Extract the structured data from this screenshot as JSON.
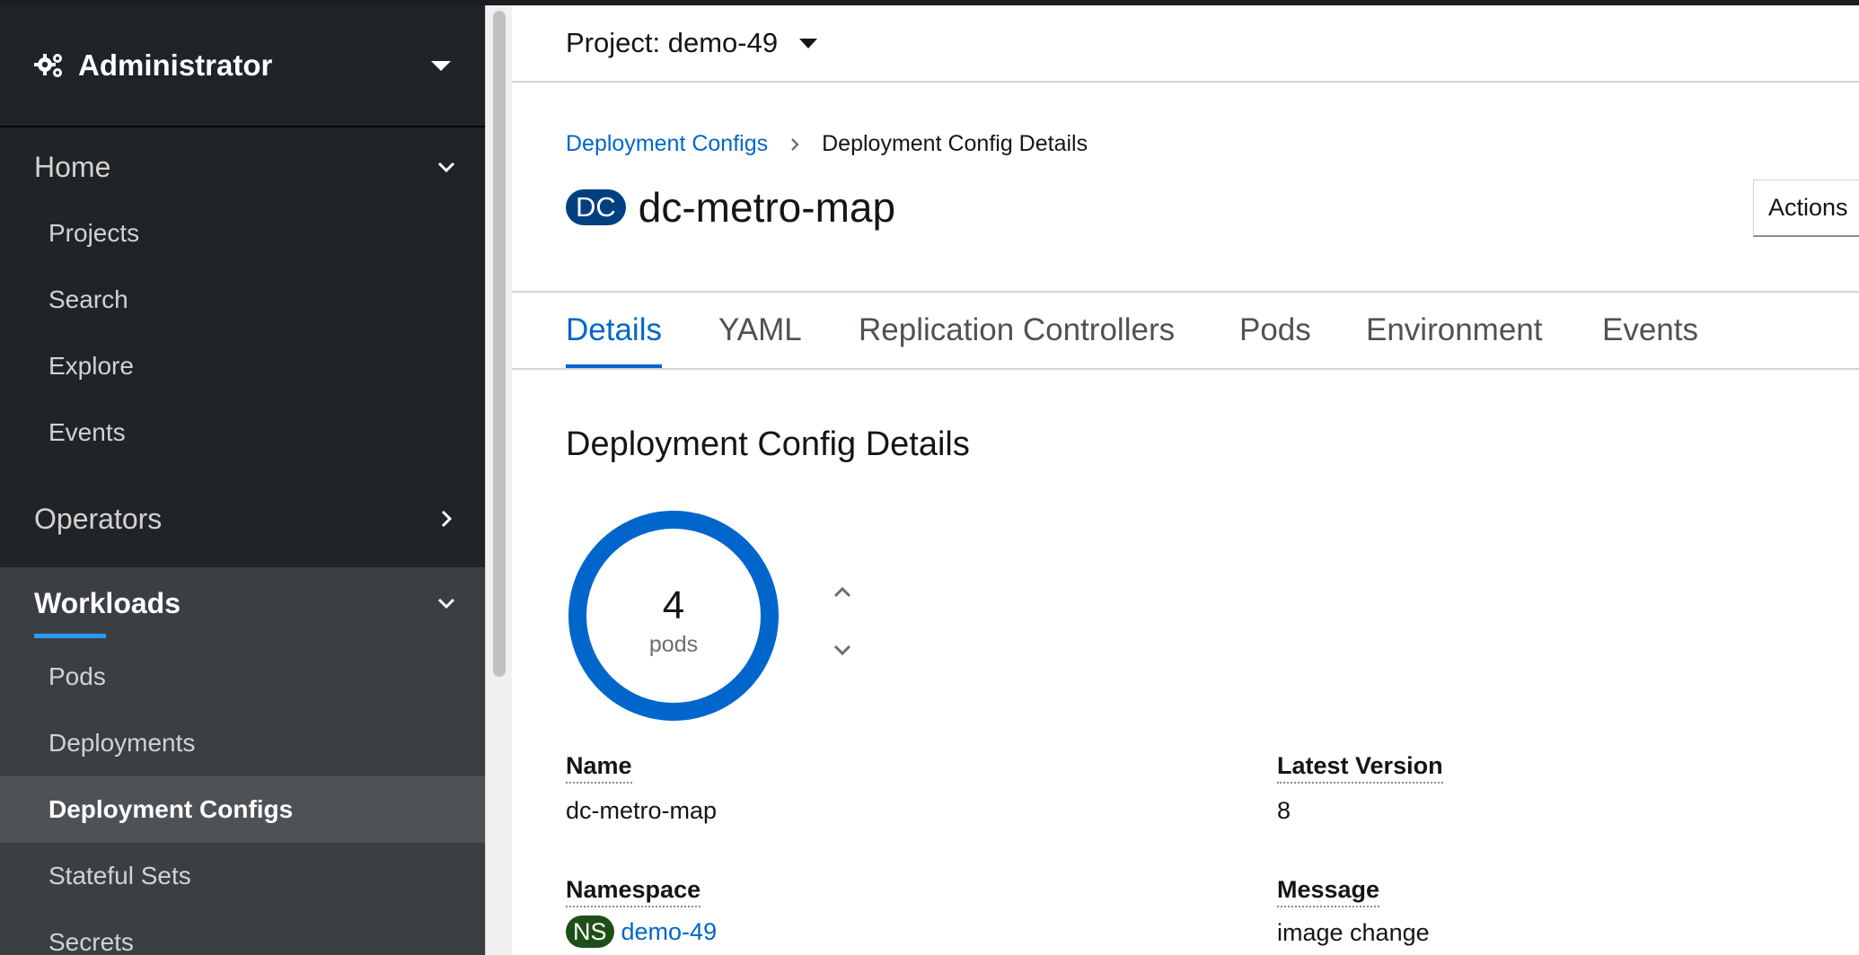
{
  "perspective": {
    "label": "Administrator",
    "icon": "gears-icon"
  },
  "nav": {
    "home": {
      "label": "Home",
      "items": [
        "Projects",
        "Search",
        "Explore",
        "Events"
      ]
    },
    "operators": {
      "label": "Operators"
    },
    "workloads": {
      "label": "Workloads",
      "items": [
        "Pods",
        "Deployments",
        "Deployment Configs",
        "Stateful Sets",
        "Secrets"
      ],
      "active": "Deployment Configs"
    }
  },
  "project": {
    "label": "Project: demo-49"
  },
  "breadcrumb": {
    "parent": "Deployment Configs",
    "current": "Deployment Config Details"
  },
  "resource": {
    "badge": "DC",
    "name": "dc-metro-map"
  },
  "actions": {
    "label": "Actions"
  },
  "tabs": [
    "Details",
    "YAML",
    "Replication Controllers",
    "Pods",
    "Environment",
    "Events"
  ],
  "active_tab": "Details",
  "details": {
    "section_title": "Deployment Config Details",
    "pods": {
      "count": "4",
      "label": "pods"
    },
    "fields": {
      "name": {
        "label": "Name",
        "value": "dc-metro-map"
      },
      "latest_version": {
        "label": "Latest Version",
        "value": "8"
      },
      "namespace": {
        "label": "Namespace",
        "badge": "NS",
        "value": "demo-49"
      },
      "message": {
        "label": "Message",
        "value": "image change"
      }
    }
  },
  "colors": {
    "accent": "#0066cc",
    "sidebar": "#212427",
    "donut": "#0066cc",
    "ns_badge": "#1e4f18",
    "dc_badge": "#004080"
  }
}
